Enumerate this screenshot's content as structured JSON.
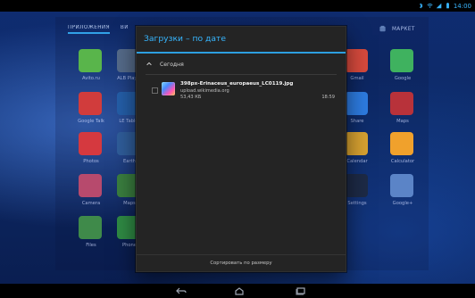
{
  "statusbar": {
    "time": "14:00",
    "icons": [
      "bluetooth-icon",
      "wifi-icon",
      "signal-icon",
      "battery-icon"
    ]
  },
  "launcher": {
    "tabs": [
      {
        "label": "ПРИЛОЖЕНИЯ",
        "active": true
      },
      {
        "label": "ВИ",
        "active": false
      }
    ],
    "market_label": "МАРКЕТ",
    "apps": [
      {
        "label": "Avito.ru",
        "color": "#59b54b",
        "icon": "avito-icon"
      },
      {
        "label": "ALB Player",
        "color": "#556b8a",
        "icon": "player-icon"
      },
      {
        "label": "Gmail",
        "color": "#d74a3d",
        "icon": "gmail-icon"
      },
      {
        "label": "Google",
        "color": "#3fb25f",
        "icon": "google-icon"
      },
      {
        "label": "Google Talk",
        "color": "#d13c3c",
        "icon": "talk-icon"
      },
      {
        "label": "LE Tablet",
        "color": "#245ea8",
        "icon": "le-icon"
      },
      {
        "label": "Share",
        "color": "#2d7be0",
        "icon": "share-icon"
      },
      {
        "label": "Maps",
        "color": "#b8323a",
        "icon": "maps-icon"
      },
      {
        "label": "Photos",
        "color": "#d5393f",
        "icon": "photos-icon"
      },
      {
        "label": "Earth",
        "color": "#2f5d9a",
        "icon": "earth-icon"
      },
      {
        "label": "Calendar",
        "color": "#d6a131",
        "icon": "calendar-icon"
      },
      {
        "label": "Calculator",
        "color": "#f0a12c",
        "icon": "calculator-icon"
      },
      {
        "label": "Camera",
        "color": "#b74a6d",
        "icon": "camera-icon"
      },
      {
        "label": "Maps",
        "color": "#3a7e3f",
        "icon": "maps2-icon"
      },
      {
        "label": "Settings",
        "color": "#1d2a46",
        "icon": "settings-icon"
      },
      {
        "label": "Google+",
        "color": "#5b84c7",
        "icon": "googleplus-icon"
      },
      {
        "label": "Files",
        "color": "#3f8a4a",
        "icon": "files-icon"
      },
      {
        "label": "Phone",
        "color": "#2f8a44",
        "icon": "phone-icon"
      }
    ]
  },
  "downloads": {
    "title": "Загрузки – по дате",
    "section_label": "Сегодня",
    "items": [
      {
        "name": "398px-Erinaceus_europaeus_LC0119.jpg",
        "source": "upload.wikimedia.org",
        "size": "53,43 КБ",
        "time": "18:59"
      }
    ],
    "footer_action": "Сортировать по размеру"
  },
  "navbar": {
    "buttons": [
      "back-icon",
      "home-icon",
      "recent-apps-icon"
    ]
  }
}
